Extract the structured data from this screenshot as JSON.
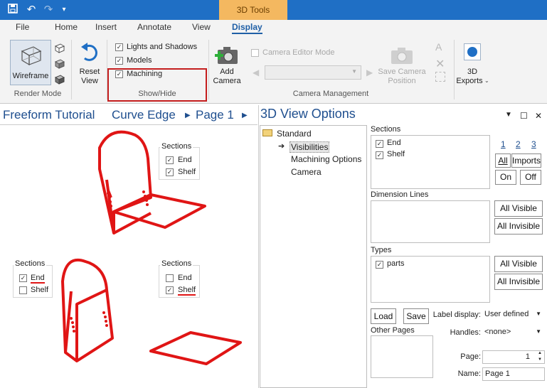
{
  "titlebar": {
    "context_tab": "3D Tools"
  },
  "tabs": [
    {
      "label": "File"
    },
    {
      "label": "Home"
    },
    {
      "label": "Insert"
    },
    {
      "label": "Annotate"
    },
    {
      "label": "View"
    },
    {
      "label": "Display"
    }
  ],
  "ribbon": {
    "render_mode": {
      "wireframe_label": "Wireframe",
      "group_label": "Render Mode"
    },
    "reset_view": {
      "line1": "Reset",
      "line2": "View"
    },
    "show_hide": {
      "lights_and_shadows": "Lights and Shadows",
      "models": "Models",
      "machining": "Machining",
      "group_label": "Show/Hide"
    },
    "camera": {
      "add_line1": "Add",
      "add_line2": "Camera",
      "editor_mode": "Camera Editor Mode",
      "save_line1": "Save Camera",
      "save_line2": "Position",
      "group_label": "Camera Management"
    },
    "exports": {
      "line1": "3D",
      "line2": "Exports"
    }
  },
  "left": {
    "breadcrumb": [
      "Freeform Tutorial",
      "Curve Edge",
      "Page 1"
    ],
    "sections_top": {
      "title": "Sections",
      "end": "End",
      "shelf": "Shelf"
    },
    "sections_left": {
      "title": "Sections",
      "end": "End",
      "shelf": "Shelf"
    },
    "sections_right": {
      "title": "Sections",
      "end": "End",
      "shelf": "Shelf"
    }
  },
  "panel": {
    "title": "3D View Options",
    "tree": {
      "root": "Standard",
      "items": [
        "Visibilities",
        "Machining Options",
        "Camera"
      ]
    },
    "sections": {
      "label": "Sections",
      "items": [
        "End",
        "Shelf"
      ],
      "nums": [
        "1",
        "2",
        "3"
      ],
      "all": "All",
      "imports": "Imports",
      "on": "On",
      "off": "Off"
    },
    "dimension_lines": {
      "label": "Dimension Lines",
      "all_visible": "All Visible",
      "all_invisible": "All Invisible"
    },
    "types": {
      "label": "Types",
      "items": [
        "parts"
      ],
      "all_visible": "All Visible",
      "all_invisible": "All Invisible"
    },
    "load": "Load",
    "save": "Save",
    "label_display": {
      "label": "Label display:",
      "value": "User defined"
    },
    "other_pages": "Other Pages",
    "handles": {
      "label": "Handles:",
      "value": "<none>"
    },
    "page": {
      "label": "Page:",
      "value": "1"
    },
    "name": {
      "label": "Name:",
      "value": "Page 1"
    }
  },
  "colors": {
    "accent": "#1f6fc5",
    "context": "#f4b860",
    "model": "#e01515",
    "highlight": "#c41e1e"
  }
}
